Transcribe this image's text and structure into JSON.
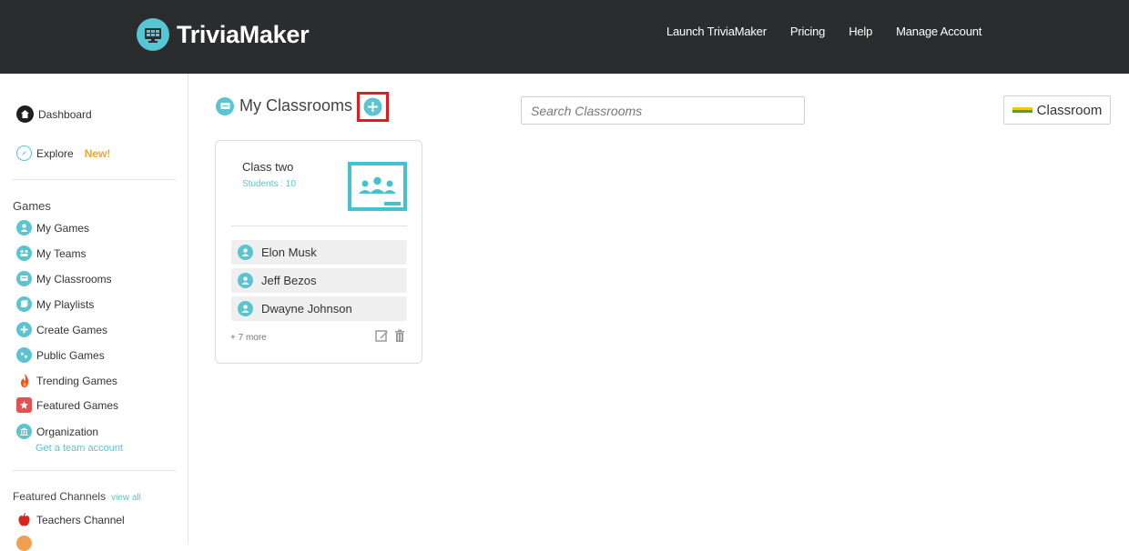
{
  "header": {
    "logo_text": "TriviaMaker",
    "nav": [
      "Launch TriviaMaker",
      "Pricing",
      "Help",
      "Manage Account"
    ]
  },
  "sidebar": {
    "dashboard": "Dashboard",
    "explore": "Explore",
    "explore_badge": "New!",
    "games_heading": "Games",
    "games_items": [
      "My Games",
      "My Teams",
      "My Classrooms",
      "My Playlists",
      "Create Games",
      "Public Games",
      "Trending Games",
      "Featured Games",
      "Organization"
    ],
    "organization_sub": "Get a team account",
    "channels_heading": "Featured Channels",
    "channels_view_all": "view all",
    "channels": [
      "Teachers Channel"
    ]
  },
  "main": {
    "title": "My Classrooms",
    "search_placeholder": "Search Classrooms",
    "classroom_button": "Classroom"
  },
  "card": {
    "name": "Class two",
    "students_label": "Students : 10",
    "students": [
      "Elon Musk",
      "Jeff Bezos",
      "Dwayne Johnson"
    ],
    "more": "+ 7 more"
  },
  "colors": {
    "header_bg": "#2b2c2e",
    "accent": "#5bc4d1",
    "badge": "#f5a623",
    "highlight": "#e21b23"
  }
}
